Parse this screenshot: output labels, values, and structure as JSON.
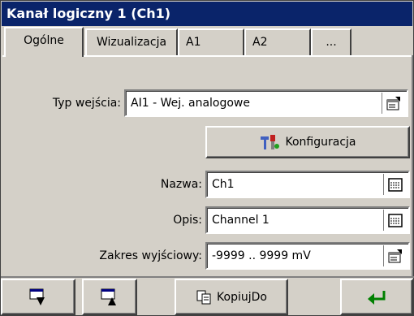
{
  "window": {
    "title": "Kanał logiczny 1 (Ch1)"
  },
  "tabs": [
    {
      "label": "Ogólne",
      "active": true
    },
    {
      "label": "Wizualizacja",
      "active": false
    },
    {
      "label": "A1",
      "active": false
    },
    {
      "label": "A2",
      "active": false
    },
    {
      "label": "...",
      "active": false
    }
  ],
  "form": {
    "input_type": {
      "label": "Typ wejścia:",
      "value": "AI1 - Wej. analogowe",
      "icon": "properties-icon"
    },
    "config_button": {
      "label": "Konfiguracja",
      "icon": "configuration-tool-icon"
    },
    "name": {
      "label": "Nazwa:",
      "value": "Ch1",
      "icon": "keyboard-icon"
    },
    "description": {
      "label": "Opis:",
      "value": "Channel 1",
      "icon": "keyboard-icon"
    },
    "output_range": {
      "label": "Zakres wyjściowy:",
      "value": "-9999 .. 9999 mV",
      "icon": "properties-icon"
    }
  },
  "toolbar": {
    "prev_icon": "window-down-arrow-icon",
    "next_icon": "window-up-arrow-icon",
    "copy_label": "KopiujDo",
    "copy_icon": "copy-icon",
    "enter_icon": "enter-arrow-icon",
    "enter_color": "#008000"
  }
}
